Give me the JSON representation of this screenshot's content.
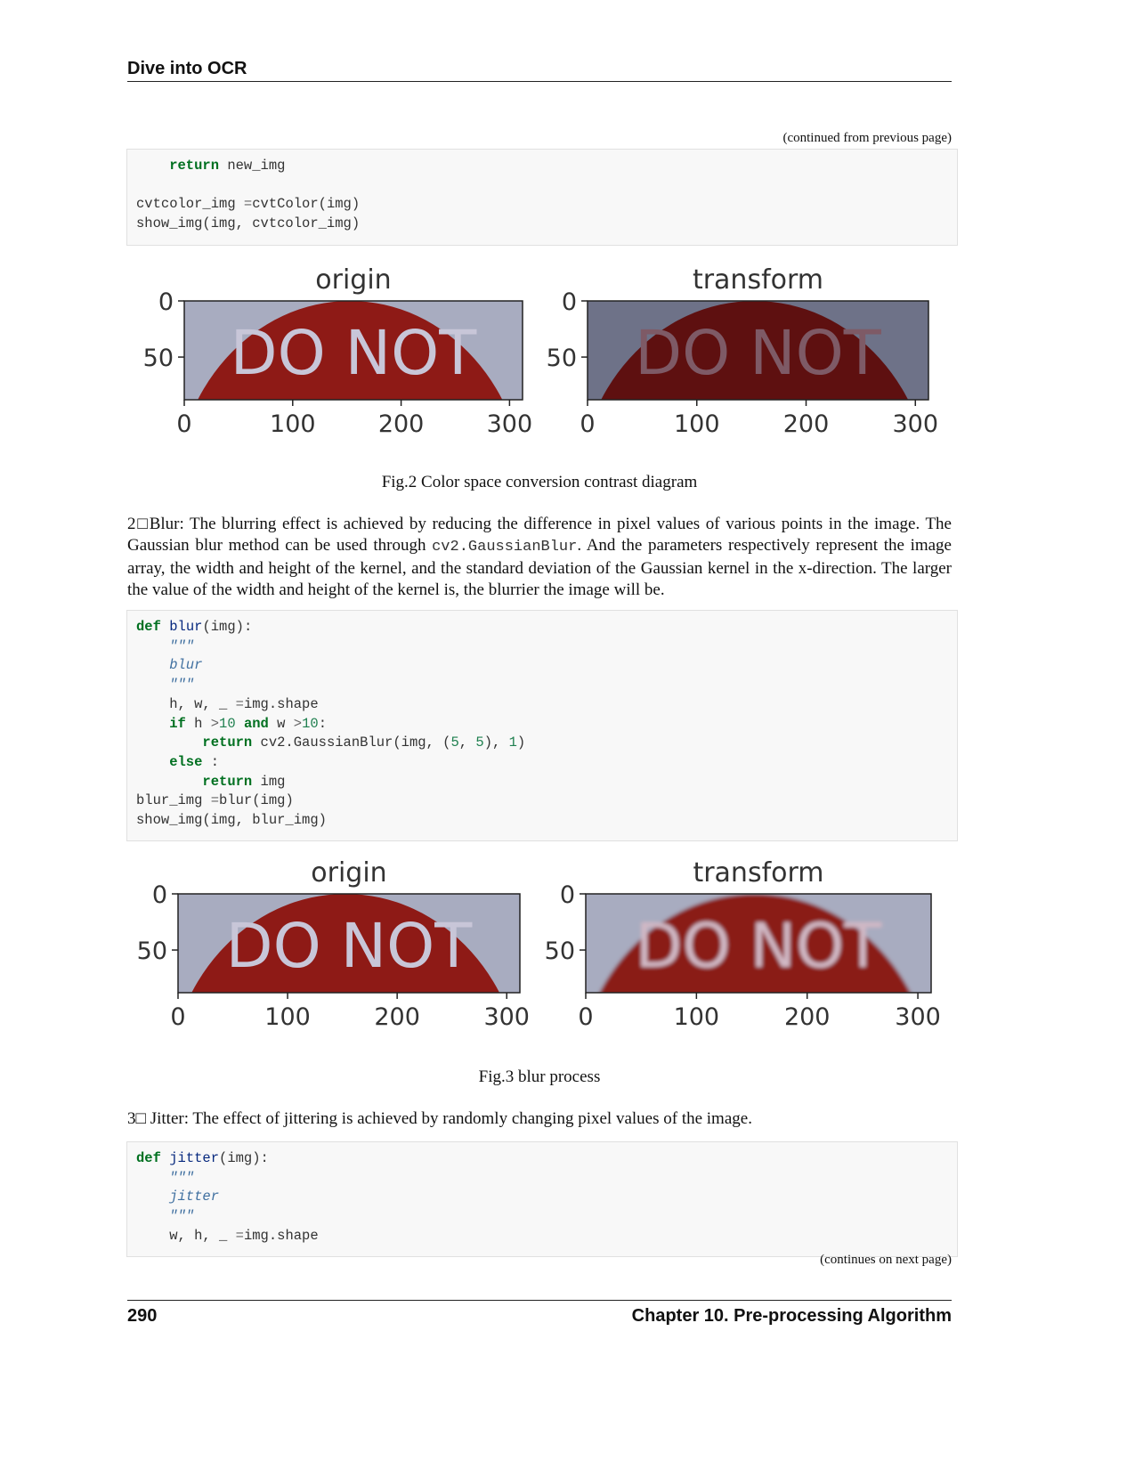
{
  "header": {
    "title": "Dive into OCR"
  },
  "continued_from": "(continued from previous page)",
  "continues_on": "(continues on next page)",
  "code1": [
    [
      [
        "k",
        "    return"
      ],
      [
        "",
        "new_img"
      ]
    ],
    [],
    [
      [
        "",
        "cvtcolor_img "
      ],
      [
        "o",
        "="
      ],
      [
        "",
        "cvtColor(img)"
      ]
    ],
    [
      [
        "",
        "show_img(img, cvtcolor_img)"
      ]
    ]
  ],
  "fig2": {
    "caption": "Fig.2 Color space conversion contrast diagram",
    "panels": [
      {
        "title": "origin",
        "image_text": "DO NOT",
        "variant": "origin"
      },
      {
        "title": "transform",
        "image_text": "DO NOT",
        "variant": "dark"
      }
    ]
  },
  "axes": {
    "x_ticks": [
      "0",
      "100",
      "200",
      "300"
    ],
    "y_ticks": [
      "0",
      "50"
    ]
  },
  "para_blur": {
    "prefix": "2□Blur: The blurring effect is achieved by reducing the difference in pixel values of various points in the image. The Gaussian blur method can be used through ",
    "code": "cv2.GaussianBlur",
    "suffix": ". And the parameters respectively represent the image array, the width and height of the kernel, and the standard deviation of the Gaussian kernel in the x-direction. The larger the value of the width and height of the kernel is, the blurrier the image will be."
  },
  "code2": [
    [
      [
        "k",
        "def"
      ],
      [
        "",
        ""
      ],
      [
        "nf",
        "blur"
      ],
      [
        "",
        "(img):"
      ]
    ],
    [
      [
        "s",
        "    \"\"\""
      ]
    ],
    [
      [
        "s",
        "    blur"
      ]
    ],
    [
      [
        "s",
        "    \"\"\""
      ]
    ],
    [
      [
        "",
        "    h, w, _ "
      ],
      [
        "o",
        "="
      ],
      [
        "",
        "img.shape"
      ]
    ],
    [
      [
        "k",
        "    if"
      ],
      [
        "",
        "h "
      ],
      [
        "o",
        ">"
      ],
      [
        "m",
        "10"
      ],
      [
        "k",
        "and"
      ],
      [
        "",
        "w "
      ],
      [
        "o",
        ">"
      ],
      [
        "m",
        "10"
      ],
      [
        "",
        ":"
      ]
    ],
    [
      [
        "k",
        "        return"
      ],
      [
        "",
        "cv2.GaussianBlur(img, ("
      ],
      [
        "m",
        "5"
      ],
      [
        "",
        ", "
      ],
      [
        "m",
        "5"
      ],
      [
        "",
        "), "
      ],
      [
        "m",
        "1"
      ],
      [
        "",
        ")"
      ]
    ],
    [
      [
        "k",
        "    else"
      ],
      [
        "",
        ":"
      ]
    ],
    [
      [
        "k",
        "        return"
      ],
      [
        "",
        "img"
      ]
    ],
    [
      [
        "",
        "blur_img "
      ],
      [
        "o",
        "="
      ],
      [
        "",
        "blur(img)"
      ]
    ],
    [
      [
        "",
        "show_img(img, blur_img)"
      ]
    ]
  ],
  "fig3": {
    "caption": "Fig.3 blur process",
    "panels": [
      {
        "title": "origin",
        "image_text": "DO NOT",
        "variant": "origin"
      },
      {
        "title": "transform",
        "image_text": "DO NOT",
        "variant": "blur"
      }
    ]
  },
  "para_jitter": "3□ Jitter: The effect of jittering is achieved by randomly changing pixel values of the image.",
  "code3": [
    [
      [
        "k",
        "def"
      ],
      [
        "",
        ""
      ],
      [
        "nf",
        "jitter"
      ],
      [
        "",
        "(img):"
      ]
    ],
    [
      [
        "s",
        "    \"\"\""
      ]
    ],
    [
      [
        "s",
        "    jitter"
      ]
    ],
    [
      [
        "s",
        "    \"\"\""
      ]
    ],
    [
      [
        "",
        "    w, h, _ "
      ],
      [
        "o",
        "="
      ],
      [
        "",
        "img.shape"
      ]
    ]
  ],
  "footer": {
    "page": "290",
    "chapter": "Chapter 10.  Pre-processing Algorithm"
  }
}
